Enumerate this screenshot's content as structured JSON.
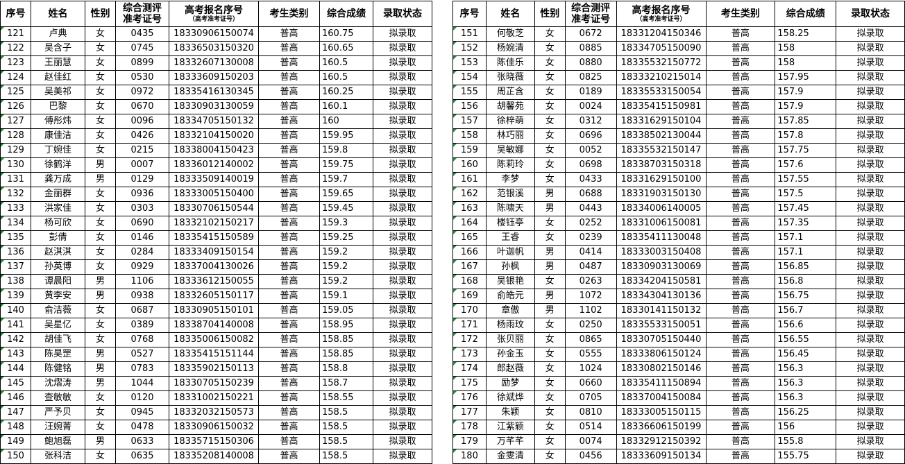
{
  "headers": {
    "seq": "序号",
    "name": "姓名",
    "gender": "性别",
    "eval_line1": "综合测评",
    "eval_line2": "准考证号",
    "reg_line1": "高考报名序号",
    "reg_line2": "（高考准考证号）",
    "category": "考生类别",
    "score": "综合成绩",
    "status": "录取状态"
  },
  "left_rows": [
    [
      "121",
      "卢典",
      "女",
      "0435",
      "18330906150074",
      "普高",
      "160.75",
      "拟录取"
    ],
    [
      "122",
      "吴含子",
      "女",
      "0745",
      "18336503150320",
      "普高",
      "160.65",
      "拟录取"
    ],
    [
      "123",
      "王丽慧",
      "女",
      "0899",
      "18332607130008",
      "普高",
      "160.5",
      "拟录取"
    ],
    [
      "124",
      "赵佳红",
      "女",
      "0530",
      "18333609150203",
      "普高",
      "160.5",
      "拟录取"
    ],
    [
      "125",
      "吴美祁",
      "女",
      "0972",
      "18335416130345",
      "普高",
      "160.25",
      "拟录取"
    ],
    [
      "126",
      "巴黎",
      "女",
      "0670",
      "18330903130059",
      "普高",
      "160.1",
      "拟录取"
    ],
    [
      "127",
      "傅彤炜",
      "女",
      "0096",
      "18334705150132",
      "普高",
      "160",
      "拟录取"
    ],
    [
      "128",
      "康佳洁",
      "女",
      "0426",
      "18332104150020",
      "普高",
      "159.95",
      "拟录取"
    ],
    [
      "129",
      "丁婉佳",
      "女",
      "0215",
      "18338004150423",
      "普高",
      "159.8",
      "拟录取"
    ],
    [
      "130",
      "徐鹤洋",
      "男",
      "0007",
      "18336012140002",
      "普高",
      "159.75",
      "拟录取"
    ],
    [
      "131",
      "龚万成",
      "男",
      "0129",
      "18333509140019",
      "普高",
      "159.7",
      "拟录取"
    ],
    [
      "132",
      "金丽群",
      "女",
      "0936",
      "18333005150400",
      "普高",
      "159.65",
      "拟录取"
    ],
    [
      "133",
      "洪家佳",
      "女",
      "0303",
      "18330706150544",
      "普高",
      "159.45",
      "拟录取"
    ],
    [
      "134",
      "杨可欣",
      "女",
      "0690",
      "18332102150217",
      "普高",
      "159.3",
      "拟录取"
    ],
    [
      "135",
      "彭倩",
      "女",
      "0146",
      "18335415150589",
      "普高",
      "159.25",
      "拟录取"
    ],
    [
      "136",
      "赵淇淇",
      "女",
      "0284",
      "18333409150154",
      "普高",
      "159.2",
      "拟录取"
    ],
    [
      "137",
      "孙英博",
      "女",
      "0929",
      "18337004130026",
      "普高",
      "159.2",
      "拟录取"
    ],
    [
      "138",
      "谭晨阳",
      "男",
      "1106",
      "18333612150055",
      "普高",
      "159.2",
      "拟录取"
    ],
    [
      "139",
      "黄李安",
      "男",
      "0938",
      "18332605150117",
      "普高",
      "159.1",
      "拟录取"
    ],
    [
      "140",
      "俞洁薇",
      "女",
      "0687",
      "18330905150101",
      "普高",
      "159.05",
      "拟录取"
    ],
    [
      "141",
      "吴星亿",
      "女",
      "0389",
      "18338704140008",
      "普高",
      "158.95",
      "拟录取"
    ],
    [
      "142",
      "胡佳飞",
      "女",
      "0768",
      "18335006150082",
      "普高",
      "158.85",
      "拟录取"
    ],
    [
      "143",
      "陈昊罡",
      "男",
      "0527",
      "18335415151144",
      "普高",
      "158.85",
      "拟录取"
    ],
    [
      "144",
      "陈健铭",
      "男",
      "0783",
      "18335902150113",
      "普高",
      "158.8",
      "拟录取"
    ],
    [
      "145",
      "沈熠涛",
      "男",
      "1044",
      "18330705150239",
      "普高",
      "158.7",
      "拟录取"
    ],
    [
      "146",
      "查敏敏",
      "女",
      "0120",
      "18331002150221",
      "普高",
      "158.55",
      "拟录取"
    ],
    [
      "147",
      "严予贝",
      "女",
      "0945",
      "18332032150573",
      "普高",
      "158.5",
      "拟录取"
    ],
    [
      "148",
      "汪婉菁",
      "女",
      "0478",
      "18330906150032",
      "普高",
      "158.5",
      "拟录取"
    ],
    [
      "149",
      "鲍旭磊",
      "男",
      "0633",
      "18335715150306",
      "普高",
      "158.5",
      "拟录取"
    ],
    [
      "150",
      "张科洁",
      "女",
      "0635",
      "18335208140008",
      "普高",
      "158.5",
      "拟录取"
    ]
  ],
  "right_rows": [
    [
      "151",
      "何敬芝",
      "女",
      "0672",
      "18331204150346",
      "普高",
      "158.25",
      "拟录取"
    ],
    [
      "152",
      "杨婉清",
      "女",
      "0885",
      "18334705150090",
      "普高",
      "158",
      "拟录取"
    ],
    [
      "153",
      "陈佳乐",
      "女",
      "0880",
      "18335532150772",
      "普高",
      "158",
      "拟录取"
    ],
    [
      "154",
      "张晓薇",
      "女",
      "0825",
      "18333210215014",
      "普高",
      "157.95",
      "拟录取"
    ],
    [
      "155",
      "周芷含",
      "女",
      "0189",
      "18335533150054",
      "普高",
      "157.9",
      "拟录取"
    ],
    [
      "156",
      "胡馨苑",
      "女",
      "0024",
      "18335415150981",
      "普高",
      "157.9",
      "拟录取"
    ],
    [
      "157",
      "徐梓萌",
      "女",
      "0312",
      "18331629150104",
      "普高",
      "157.85",
      "拟录取"
    ],
    [
      "158",
      "林巧丽",
      "女",
      "0696",
      "18338502130044",
      "普高",
      "157.8",
      "拟录取"
    ],
    [
      "159",
      "吴敏娜",
      "女",
      "0052",
      "18335532150147",
      "普高",
      "157.75",
      "拟录取"
    ],
    [
      "160",
      "陈莉玲",
      "女",
      "0698",
      "18338703150318",
      "普高",
      "157.6",
      "拟录取"
    ],
    [
      "161",
      "李梦",
      "女",
      "0433",
      "18331629150100",
      "普高",
      "157.55",
      "拟录取"
    ],
    [
      "162",
      "范银溪",
      "男",
      "0688",
      "18331903150130",
      "普高",
      "157.5",
      "拟录取"
    ],
    [
      "163",
      "陈啸天",
      "男",
      "0443",
      "18334006140005",
      "普高",
      "157.45",
      "拟录取"
    ],
    [
      "164",
      "楼钰亭",
      "女",
      "0252",
      "18331006150081",
      "普高",
      "157.35",
      "拟录取"
    ],
    [
      "165",
      "王睿",
      "女",
      "0239",
      "18335411130048",
      "普高",
      "157.1",
      "拟录取"
    ],
    [
      "166",
      "叶迦帆",
      "男",
      "0414",
      "18333003150408",
      "普高",
      "157.1",
      "拟录取"
    ],
    [
      "167",
      "孙枫",
      "男",
      "0487",
      "18330903130069",
      "普高",
      "156.85",
      "拟录取"
    ],
    [
      "168",
      "吴银艳",
      "女",
      "0263",
      "18334204150581",
      "普高",
      "156.8",
      "拟录取"
    ],
    [
      "169",
      "俞皓元",
      "男",
      "1072",
      "18334304130136",
      "普高",
      "156.75",
      "拟录取"
    ],
    [
      "170",
      "章傲",
      "男",
      "1102",
      "18330141150132",
      "普高",
      "156.7",
      "拟录取"
    ],
    [
      "171",
      "杨雨玟",
      "女",
      "0250",
      "18335533150051",
      "普高",
      "156.6",
      "拟录取"
    ],
    [
      "172",
      "张贝丽",
      "女",
      "0865",
      "18330705150440",
      "普高",
      "156.55",
      "拟录取"
    ],
    [
      "173",
      "孙金玉",
      "女",
      "0555",
      "18333806150124",
      "普高",
      "156.45",
      "拟录取"
    ],
    [
      "174",
      "郎赵薇",
      "女",
      "1024",
      "18330802150146",
      "普高",
      "156.3",
      "拟录取"
    ],
    [
      "175",
      "励梦",
      "女",
      "0660",
      "18335411150894",
      "普高",
      "156.3",
      "拟录取"
    ],
    [
      "176",
      "徐斌烨",
      "女",
      "0705",
      "18337004150084",
      "普高",
      "156.3",
      "拟录取"
    ],
    [
      "177",
      "朱颖",
      "女",
      "0810",
      "18333005150115",
      "普高",
      "156.25",
      "拟录取"
    ],
    [
      "178",
      "江紫颖",
      "女",
      "0514",
      "18336606150199",
      "普高",
      "156",
      "拟录取"
    ],
    [
      "179",
      "万芊芊",
      "女",
      "0074",
      "18332912150392",
      "普高",
      "155.8",
      "拟录取"
    ],
    [
      "180",
      "金雯清",
      "女",
      "0456",
      "18333609150134",
      "普高",
      "155.75",
      "拟录取"
    ]
  ]
}
